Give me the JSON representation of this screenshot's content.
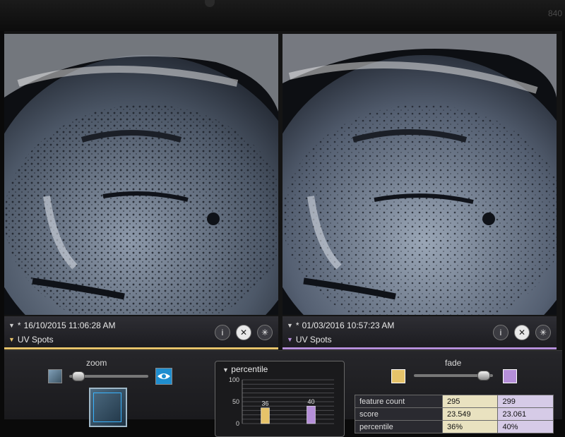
{
  "device": {
    "bezel_label": "840"
  },
  "panes": [
    {
      "timestamp": "16/10/2015 11:06:28 AM",
      "mode": "UV Spots",
      "accent": "#e6c36a"
    },
    {
      "timestamp": "01/03/2016 10:57:23 AM",
      "mode": "UV Spots",
      "accent": "#b58fd9"
    }
  ],
  "icons": [
    "info-icon",
    "close-icon",
    "settings-icon"
  ],
  "zoom": {
    "label": "zoom",
    "level": 0.1
  },
  "fade": {
    "label": "fade",
    "level": 0.82
  },
  "percentile_panel": {
    "title": "percentile"
  },
  "chart_data": {
    "type": "bar",
    "categories": [
      "",
      ""
    ],
    "values": [
      36,
      40
    ],
    "value_labels": [
      "36",
      "40"
    ],
    "ylim": [
      0,
      100
    ],
    "yticks": [
      "100",
      "50",
      "0"
    ],
    "colors": [
      "#e6c36a",
      "#b58fd9"
    ],
    "grid": true
  },
  "stats": {
    "rows": [
      {
        "label": "feature count",
        "a": "295",
        "b": "299"
      },
      {
        "label": "score",
        "a": "23.549",
        "b": "23.061"
      },
      {
        "label": "percentile",
        "a": "36%",
        "b": "40%"
      }
    ]
  }
}
